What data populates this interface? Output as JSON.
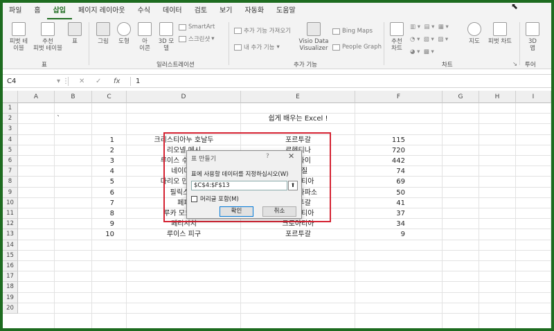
{
  "menu": {
    "tabs": [
      "파일",
      "홈",
      "삽입",
      "페이지 레이아웃",
      "수식",
      "데이터",
      "검토",
      "보기",
      "자동화",
      "도움말"
    ]
  },
  "ribbon": {
    "tables": {
      "pivot": "피벗 테\n이블",
      "recommended": "추천\n피벗 테이블",
      "table": "표",
      "group": "표"
    },
    "illustrations": {
      "picture": "그림",
      "shapes": "도형",
      "icons": "아\n이콘",
      "models": "3D 모\n델",
      "smartart": "SmartArt",
      "screenshot": "스크린샷",
      "group": "일러스트레이션"
    },
    "addins": {
      "get": "추가 기능 가져오기",
      "my": "내 추가 기능",
      "visio": "Visio Data\nVisualizer",
      "bing": "Bing Maps",
      "people": "People Graph",
      "group": "추가 기능"
    },
    "charts": {
      "recommended": "추천\n차트",
      "maps": "지도",
      "pivot": "피벗 차트",
      "group": "차트"
    },
    "tours": {
      "map3d": "3D\n맵",
      "group": "투어"
    }
  },
  "formula_bar": {
    "name_box": "C4",
    "fx": "fx",
    "value": "1"
  },
  "columns": [
    "A",
    "B",
    "C",
    "D",
    "E",
    "F",
    "G",
    "H",
    "I"
  ],
  "rows": [
    "1",
    "2",
    "3",
    "4",
    "5",
    "6",
    "7",
    "8",
    "9",
    "10",
    "11",
    "12",
    "13",
    "14",
    "15",
    "16",
    "17",
    "18",
    "19",
    "20"
  ],
  "sheet": {
    "title": "쉽게 배우는 Excel !",
    "b2_mark": "`",
    "data": [
      {
        "no": "1",
        "name": "크리스티아누 호날두",
        "country": "포르투갈",
        "value": "115"
      },
      {
        "no": "2",
        "name": "리오넬 메시",
        "country": "르헨티나",
        "value": "720"
      },
      {
        "no": "3",
        "name": "루이스 수아레스",
        "country": "우루과이",
        "value": "442"
      },
      {
        "no": "4",
        "name": "네이마르",
        "country": "브라질",
        "value": "74"
      },
      {
        "no": "5",
        "name": "마리오 만주키치",
        "country": "크로아티아",
        "value": "69"
      },
      {
        "no": "6",
        "name": "필릭스 로",
        "country": "부르키나파소",
        "value": "50"
      },
      {
        "no": "7",
        "name": "페페",
        "country": "포르투갈",
        "value": "41"
      },
      {
        "no": "8",
        "name": "루카 모드리치",
        "country": "크로아티아",
        "value": "37"
      },
      {
        "no": "9",
        "name": "페리시치",
        "country": "크로아티아",
        "value": "34"
      },
      {
        "no": "10",
        "name": "루이스 피구",
        "country": "포르투갈",
        "value": "9"
      }
    ]
  },
  "dialog": {
    "title": "표 만들기",
    "help": "?",
    "close": "✕",
    "label": "표에 사용할 데이터를 지정하십시오(W)",
    "range": "$C$4:$F$13",
    "picker": "⬆",
    "header_checkbox": "머리글 포함(M)",
    "ok": "확인",
    "cancel": "취소"
  },
  "colors": {
    "accent": "#1d6b1f",
    "selection": "#d42030"
  }
}
